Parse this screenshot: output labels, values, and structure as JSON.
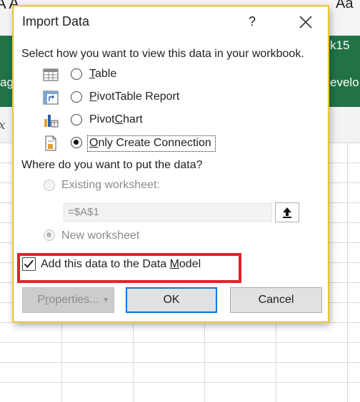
{
  "background": {
    "top_fragment": "A A",
    "top_right_fragment": "Aa",
    "ribbon_right_fragment": "k15",
    "ribbon_left_fragment": "ag",
    "ribbon_right_tab_fragment": "evelo",
    "formula_fx": "x"
  },
  "dialog": {
    "title": "Import Data",
    "help_label": "?",
    "view_prompt": "Select how you want to view this data in your workbook.",
    "view_options": [
      {
        "label_pre": "",
        "accel": "T",
        "label_post": "able",
        "icon": "table-icon",
        "checked": false
      },
      {
        "label_pre": "",
        "accel": "P",
        "label_post": "ivotTable Report",
        "icon": "pivottable-icon",
        "checked": false
      },
      {
        "label_pre": "Pivot",
        "accel": "C",
        "label_post": "hart",
        "icon": "pivotchart-icon",
        "checked": false
      },
      {
        "label_pre": "",
        "accel": "O",
        "label_post": "nly Create Connection",
        "icon": "connection-icon",
        "checked": true
      }
    ],
    "location_prompt": "Where do you want to put the data?",
    "existing_worksheet_label": "Existing worksheet:",
    "cell_reference": "=$A$1",
    "new_worksheet_label": "New worksheet",
    "data_model": {
      "label_pre": "Add this data to the Data ",
      "accel": "M",
      "label_post": "odel",
      "checked": true
    },
    "buttons": {
      "properties": {
        "pre": "P",
        "accel": "r",
        "post": "operties...",
        "chevron": "▾"
      },
      "ok": "OK",
      "cancel": "Cancel"
    }
  },
  "colors": {
    "highlight": "#e4222a",
    "ribbon": "#217346",
    "focus_border": "#0078d7"
  }
}
